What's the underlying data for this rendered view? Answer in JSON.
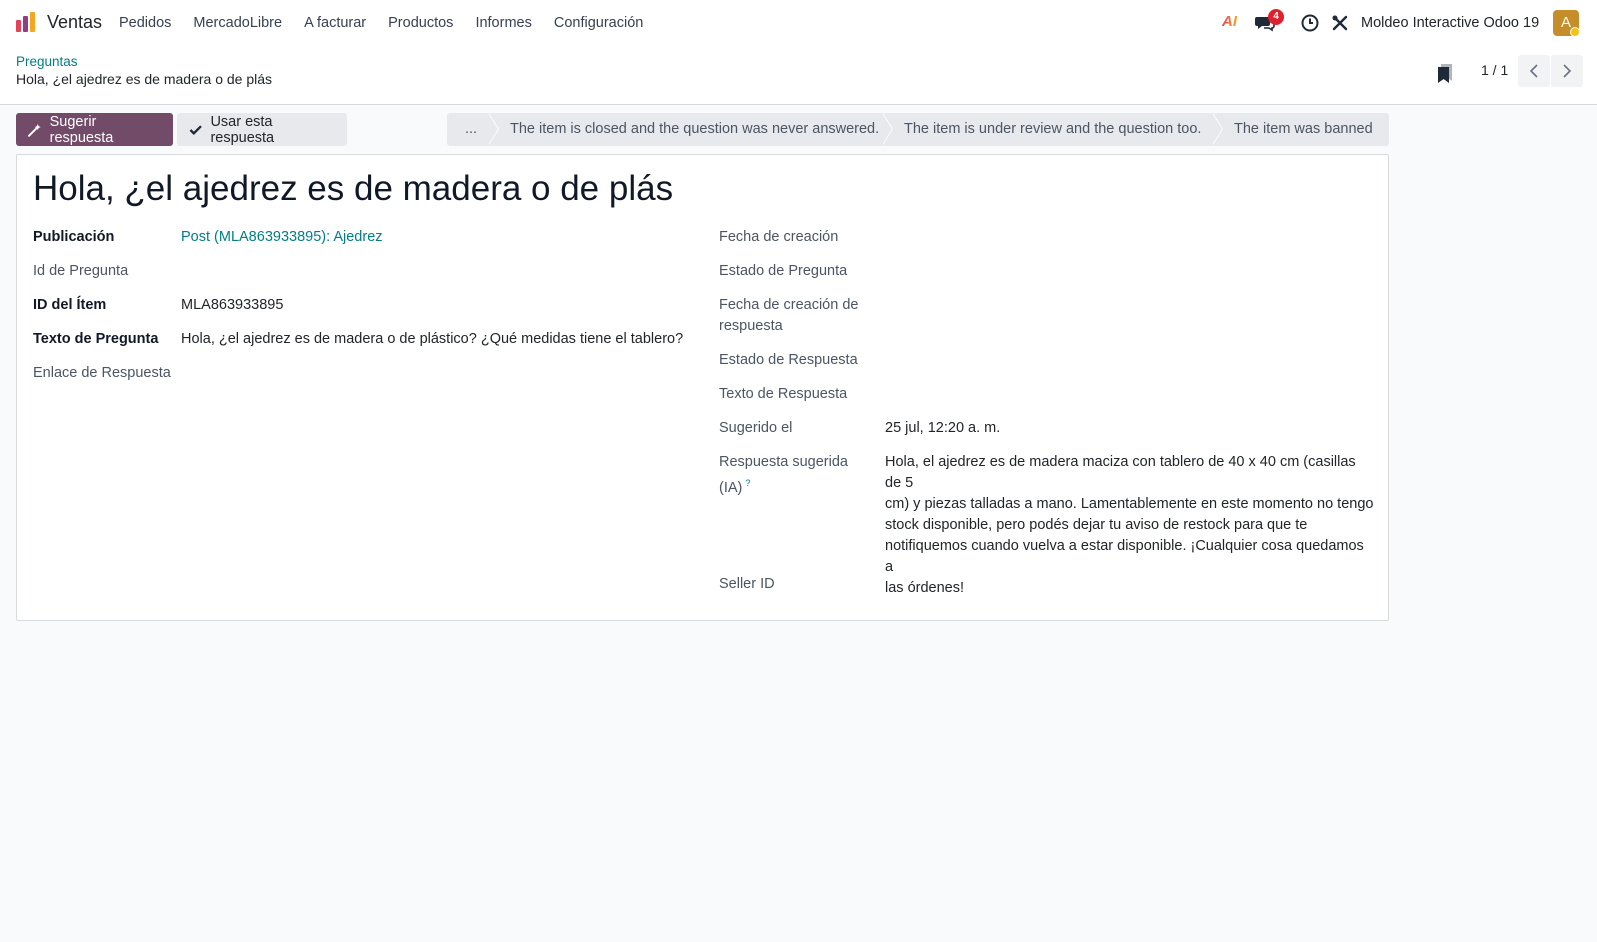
{
  "navbar": {
    "app_name": "Ventas",
    "menu": [
      "Pedidos",
      "MercadoLibre",
      "A facturar",
      "Productos",
      "Informes",
      "Configuración"
    ],
    "ai_label": "AI",
    "chat_badge": "4",
    "company": "Moldeo Interactive Odoo 19",
    "avatar_initial": "A"
  },
  "breadcrumb": {
    "parent": "Preguntas",
    "current": "Hola, ¿el ajedrez es de madera o de plás"
  },
  "pager": {
    "value": "1 / 1"
  },
  "actions": {
    "suggest": "Sugerir respuesta",
    "use": "Usar esta respuesta"
  },
  "statusbar": {
    "items": [
      "...",
      "The item is closed and the question was never answered.",
      "The item is under review and the question too.",
      "The item was banned"
    ]
  },
  "form": {
    "title": "Hola, ¿el ajedrez es de madera o de plás",
    "left": {
      "publicacion_label": "Publicación",
      "publicacion_value": "Post (MLA863933895): Ajedrez",
      "id_pregunta_label": "Id de Pregunta",
      "id_item_label": "ID del Ítem",
      "id_item_value": "MLA863933895",
      "texto_pregunta_label": "Texto de Pregunta",
      "texto_pregunta_value": "Hola, ¿el ajedrez es de madera o de plástico? ¿Qué medidas tiene el tablero?",
      "enlace_label": "Enlace de Respuesta"
    },
    "right": {
      "fecha_creacion_label": "Fecha de creación",
      "estado_pregunta_label": "Estado de Pregunta",
      "fecha_respuesta_label_1": "Fecha de creación de",
      "fecha_respuesta_label_2": "respuesta",
      "estado_respuesta_label": "Estado de Respuesta",
      "texto_respuesta_label": "Texto de Respuesta",
      "sugerido_label": "Sugerido el",
      "sugerido_value": "25 jul, 12:20 a. m.",
      "respuesta_sugerida_label_1": "Respuesta sugerida",
      "respuesta_sugerida_label_2": "(IA)",
      "help_mark": "?",
      "respuesta_sugerida_lines": [
        "Hola, el ajedrez es de madera maciza con tablero de 40 x 40 cm (casillas de 5",
        "cm) y piezas talladas a mano. Lamentablemente en este momento no tengo",
        "stock disponible, pero podés dejar tu aviso de restock para que te",
        "notifiquemos cuando vuelva a estar disponible. ¡Cualquier cosa quedamos a",
        "las órdenes!"
      ],
      "seller_id_label": "Seller ID"
    }
  },
  "colors": {
    "primary": "#714b67",
    "link": "#017e84",
    "badge": "#e0212d",
    "avatar": "#c58e2b"
  }
}
